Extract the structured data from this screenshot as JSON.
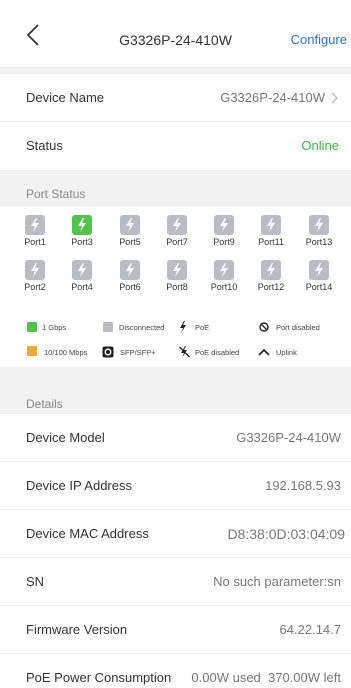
{
  "header": {
    "title": "G3326P-24-410W",
    "configure_label": "Configure"
  },
  "device": {
    "name_label": "Device Name",
    "name_value": "G3326P-24-410W",
    "status_label": "Status",
    "status_value": "Online",
    "online_color": "#44b34a"
  },
  "port_status": {
    "section_title": "Port Status",
    "ports_top": [
      {
        "label": "Port1",
        "state": "disconnected"
      },
      {
        "label": "Port3",
        "state": "1gbps"
      },
      {
        "label": "Port5",
        "state": "disconnected"
      },
      {
        "label": "Port7",
        "state": "disconnected"
      },
      {
        "label": "Port9",
        "state": "disconnected"
      },
      {
        "label": "Port11",
        "state": "disconnected"
      },
      {
        "label": "Port13",
        "state": "disconnected"
      }
    ],
    "ports_bottom": [
      {
        "label": "Port2",
        "state": "disconnected"
      },
      {
        "label": "Port4",
        "state": "disconnected"
      },
      {
        "label": "Port6",
        "state": "disconnected"
      },
      {
        "label": "Port8",
        "state": "disconnected"
      },
      {
        "label": "Port10",
        "state": "disconnected"
      },
      {
        "label": "Port12",
        "state": "disconnected"
      },
      {
        "label": "Port14",
        "state": "disconnected"
      }
    ],
    "legend": {
      "gbps": "1 Gbps",
      "disconnected": "Disconnected",
      "poe": "PoE",
      "port_disabled": "Port disabled",
      "mbps": "10/100 Mbps",
      "sfp": "SFP/SFP+",
      "poe_disabled": "PoE disabled",
      "uplink": "Uplink"
    },
    "colors": {
      "gbps": "#52c24a",
      "disconnected": "#b9bcc4",
      "mbps": "#f2a93b"
    }
  },
  "details": {
    "section_title": "Details",
    "rows": [
      {
        "label": "Device Model",
        "value": "G3326P-24-410W"
      },
      {
        "label": "Device IP Address",
        "value": "192.168.5.93"
      },
      {
        "label": "Device MAC Address",
        "value": "D8:38:0D:03:04:09"
      },
      {
        "label": "SN",
        "value": "No such parameter:sn"
      },
      {
        "label": "Firmware Version",
        "value": "64.22.14.7"
      },
      {
        "label": "PoE Power Consumption",
        "value": "0.00W used  370.00W left"
      }
    ]
  }
}
